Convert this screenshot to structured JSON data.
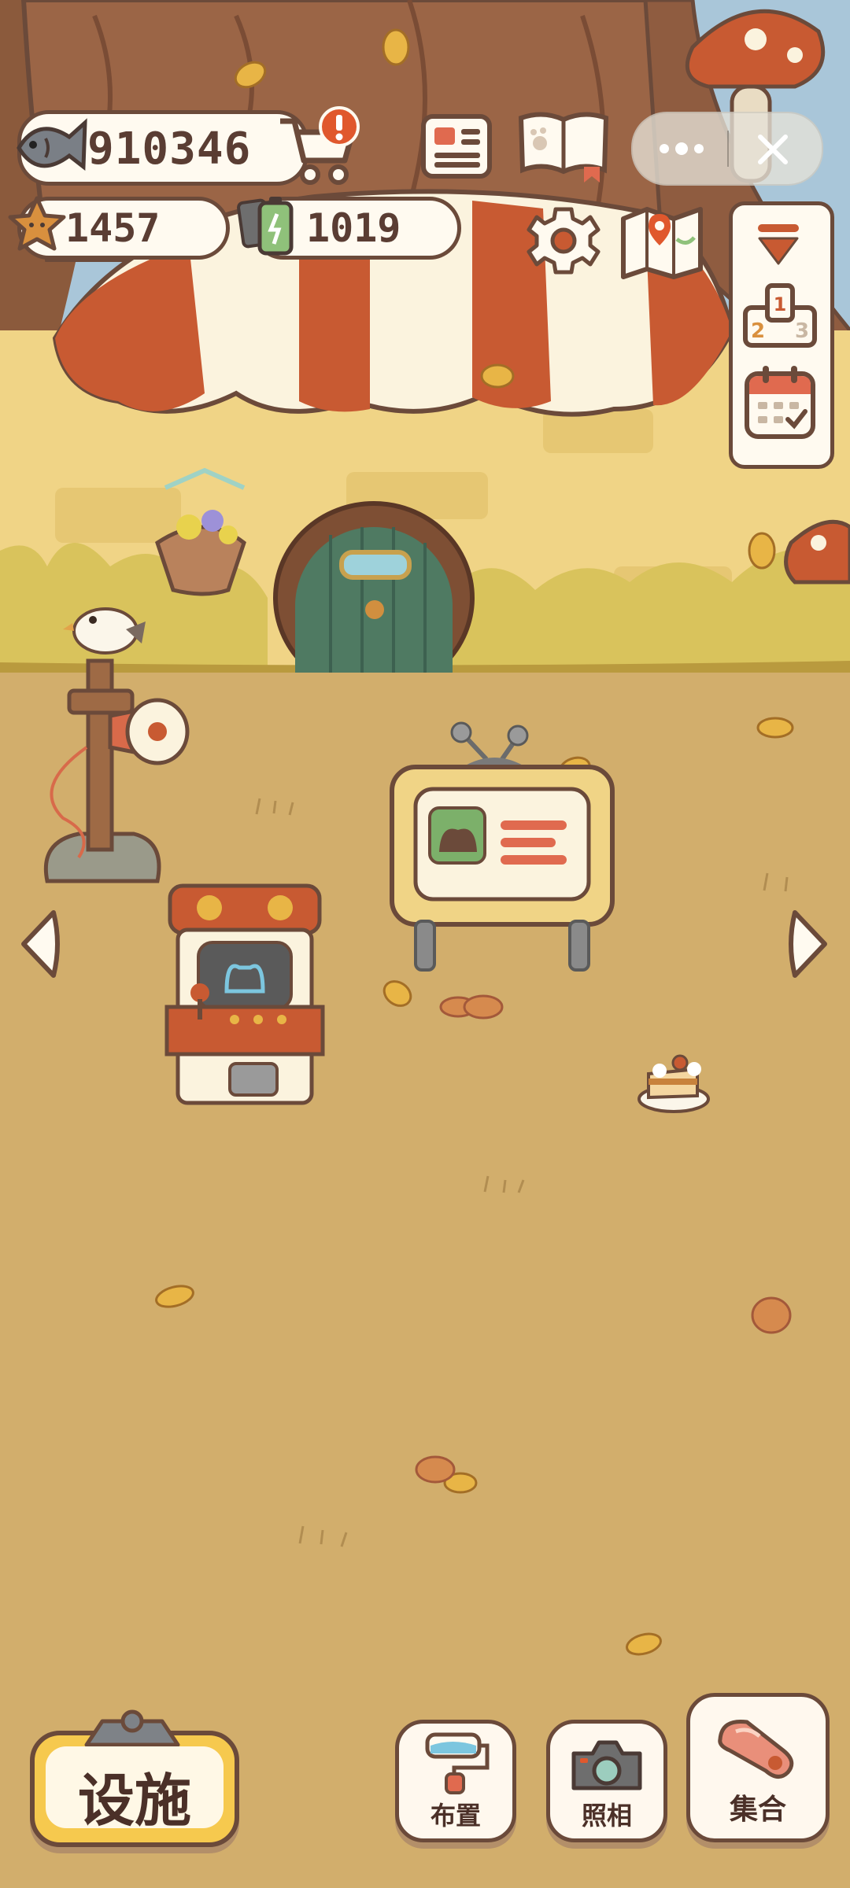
{
  "hud": {
    "fish_count": "910346",
    "star_count": "1457",
    "battery_count": "1019"
  },
  "icons": {
    "fish": "fish-icon",
    "cart": "cart-icon",
    "alert": "alert-badge-icon",
    "newspaper": "newspaper-icon",
    "pawbook": "paw-book-icon",
    "more": "more-dots-icon",
    "close": "close-icon",
    "star": "star-icon",
    "battery": "battery-icon",
    "settings": "gear-icon",
    "map": "map-icon",
    "collapse": "collapse-triangle-icon",
    "ranking": "podium-ranking-icon",
    "calendar": "calendar-icon",
    "left": "arrow-left-icon",
    "right": "arrow-right-icon",
    "paint": "paint-roller-icon",
    "camera": "camera-icon",
    "whistle": "whistle-icon"
  },
  "podium": {
    "first": "1",
    "second": "2",
    "third": "3"
  },
  "bottom_bar": {
    "facility_label": "设施",
    "layout_label": "布置",
    "photo_label": "照相",
    "gather_label": "集合"
  },
  "colors": {
    "ground": "#d2ae6c",
    "wall": "#f0d486",
    "awning_red": "#c85a32",
    "awning_cream": "#fbf3de",
    "outline": "#6b4a3a",
    "alert": "#e0582d",
    "facility_yellow": "#f6c94e"
  }
}
